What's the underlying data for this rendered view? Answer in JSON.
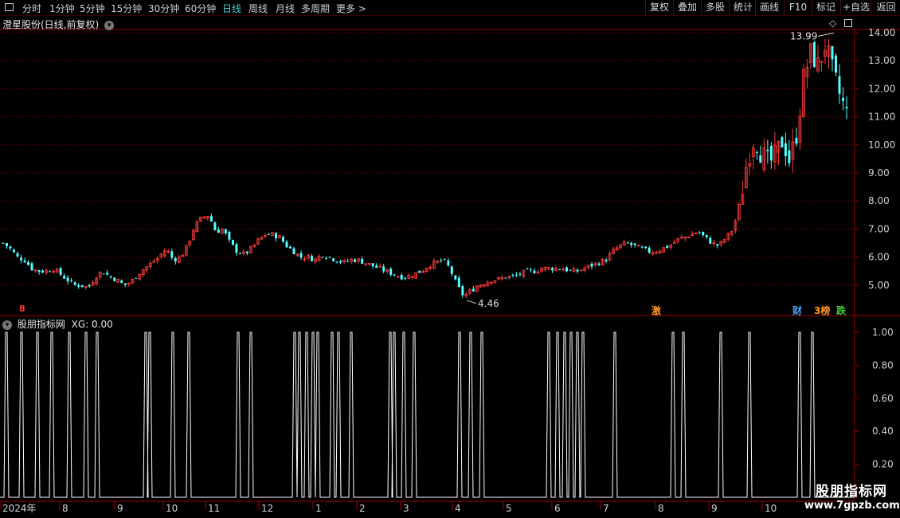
{
  "toolbar": {
    "periods": [
      "分时",
      "1分钟",
      "5分钟",
      "15分钟",
      "30分钟",
      "60分钟",
      "日线",
      "周线",
      "月线",
      "多周期",
      "更多 >"
    ],
    "active_period": "日线",
    "right_buttons": [
      "复权",
      "叠加",
      "多股",
      "统计",
      "画线",
      "F10",
      "+自选",
      "返回"
    ],
    "extra_button": "标记"
  },
  "main_panel": {
    "title": "澄星股份(日线,前复权)",
    "price_ticks": [
      "14.00",
      "13.00",
      "12.00",
      "11.00",
      "10.00",
      "9.00",
      "8.00",
      "7.00",
      "6.00",
      "5.00"
    ],
    "high_label": "13.99",
    "low_label": "4.46",
    "event_tags": [
      {
        "text": "激",
        "color": "#ff9a2e"
      },
      {
        "text": "财",
        "color": "#4aa0ff"
      },
      {
        "text": "3榜",
        "color": "#ff9a2e"
      },
      {
        "text": "跌",
        "color": "#40d040"
      }
    ],
    "small_marker": "8"
  },
  "indicator_panel": {
    "title": "股朋指标网",
    "value_label": "XG: 0.00",
    "ticks": [
      "1.00",
      "0.80",
      "0.60",
      "0.40",
      "0.20"
    ]
  },
  "time_axis": {
    "labels": [
      "2024年",
      "8",
      "9",
      "10",
      "11",
      "12",
      "1",
      "2",
      "3",
      "4",
      "5",
      "6",
      "7",
      "8",
      "9",
      "10"
    ]
  },
  "watermark": {
    "line1": "股朋指标网",
    "line2": "www.7gpzb.com"
  },
  "colors": {
    "up": "#ff3b3b",
    "down": "#54ffff",
    "grid": "#5a0000",
    "axis": "#a00000",
    "indicator": "#ffffff"
  },
  "chart_data": {
    "type": "candlestick",
    "ylim": [
      4.2,
      14.2
    ],
    "close_trace": [
      6.5,
      6.3,
      6.0,
      5.9,
      5.6,
      5.5,
      5.5,
      5.6,
      5.4,
      5.2,
      5.0,
      5.0,
      4.9,
      5.3,
      5.5,
      5.3,
      5.2,
      5.0,
      5.1,
      5.4,
      5.6,
      5.8,
      6.0,
      6.3,
      5.9,
      6.0,
      6.4,
      7.1,
      7.4,
      7.5,
      6.9,
      7.0,
      6.5,
      6.2,
      6.1,
      6.3,
      6.6,
      6.8,
      6.8,
      6.7,
      6.4,
      6.2,
      6.0,
      6.0,
      5.9,
      6.1,
      6.0,
      5.9,
      5.8,
      5.9,
      5.9,
      5.8,
      5.7,
      5.6,
      5.5,
      5.4,
      5.3,
      5.3,
      5.4,
      5.5,
      5.7,
      5.8,
      5.9,
      5.6,
      5.0,
      4.6,
      4.8,
      5.0,
      5.1,
      5.2,
      5.2,
      5.3,
      5.3,
      5.4,
      5.5,
      5.5,
      5.6,
      5.6,
      5.6,
      5.6,
      5.5,
      5.5,
      5.6,
      5.7,
      5.8,
      5.9,
      6.2,
      6.4,
      6.5,
      6.4,
      6.3,
      6.2,
      6.2,
      6.3,
      6.4,
      6.6,
      6.7,
      6.8,
      6.9,
      6.7,
      6.5,
      6.4,
      6.7,
      7.0,
      8.0,
      9.5,
      10.3,
      9.7,
      9.3,
      9.6,
      10.2,
      9.4,
      10.5,
      12.5,
      13.3,
      12.8,
      13.6,
      12.6,
      11.8,
      11.1
    ],
    "high_value": 13.99,
    "low_value": 4.46,
    "xg_signal_lines": [
      8,
      27,
      47,
      65,
      87,
      108,
      122,
      183,
      188,
      217,
      237,
      299,
      315,
      370,
      376,
      385,
      393,
      399,
      417,
      425,
      441,
      490,
      495,
      507,
      520,
      577,
      591,
      605,
      689,
      700,
      709,
      717,
      725,
      732,
      772,
      845,
      858,
      905,
      941,
      1004,
      1020
    ]
  }
}
